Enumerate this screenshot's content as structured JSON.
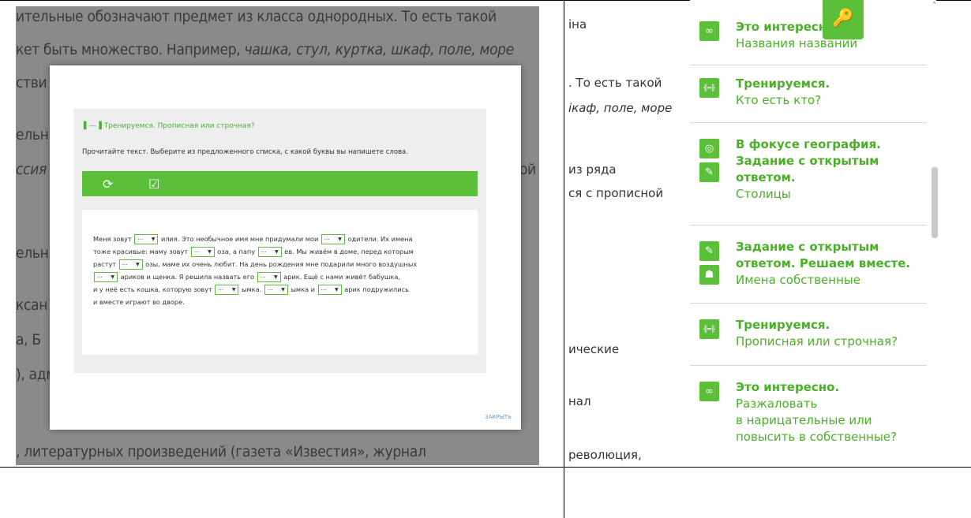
{
  "left": {
    "bg_lines": [
      {
        "text": "ительные обозначают предмет из класса однородных. То есть такой"
      },
      {
        "text": "кет быть множество. Например, ",
        "italic": "чашка, стул, куртка, шкаф, поле, море"
      },
      {
        "text": "стви"
      },
      {
        "text": "ельн"
      },
      {
        "text": "",
        "italic": "ссия"
      },
      {
        "text": "сной"
      },
      {
        "text": "ельн"
      },
      {
        "text": "ксан"
      },
      {
        "text": "а, Б"
      },
      {
        "text": "), адм"
      },
      {
        "text": ", литературных произведений (газета «Известия», журнал"
      }
    ],
    "modal": {
      "task_title": "Тренируемся. Прописная или строчная?",
      "task_desc": "Прочитайте текст. Выберите из предложенного списка, с какой буквы вы напишете слова.",
      "dropdown_value": "...",
      "close_label": "ЗАКРЫТЬ",
      "lines": [
        [
          "Меня зовут ",
          "DD",
          " илия. Это необычное имя мне придумали мои ",
          "DD",
          " одители. Их имена"
        ],
        [
          "тоже красивые: маму зовут ",
          "DD",
          " оза, а папу ",
          "DD",
          " ев. Мы живём в доме, перед которым"
        ],
        [
          "растут ",
          "DD",
          " озы, маме их очень любит. На день рождения мне подарили много воздушных"
        ],
        [
          "DD",
          " ариков и щенка. Я решила назвать его ",
          "DD",
          " арик. Ещё с нами живёт бабушка,"
        ],
        [
          "и у неё есть кошка, которую зовут ",
          "DD",
          " ымка. ",
          "DD",
          " ымка и ",
          "DD",
          " арик подружились"
        ],
        [
          "и вместе играют во дворе."
        ]
      ]
    }
  },
  "middle": [
    {
      "text": "іна"
    },
    {
      "text": ". То есть такой"
    },
    {
      "text": "",
      "italic": "ікаф, поле, море"
    },
    {
      "text": "из ряда"
    },
    {
      "text": "ся с прописной"
    },
    {
      "text": "ические"
    },
    {
      "text": "нал"
    },
    {
      "text": "революция,"
    }
  ],
  "nav": {
    "items": [
      {
        "title": [
          "Это интересно."
        ],
        "sub": [
          "Названия названий"
        ],
        "icons": [
          "binoculars-icon"
        ]
      },
      {
        "title": [
          "Тренируемся."
        ],
        "sub": [
          "Кто есть кто?"
        ],
        "icons": [
          "dumbbell-icon"
        ]
      },
      {
        "title": [
          "В фокусе география.",
          "Задание с открытым",
          "ответом."
        ],
        "sub": [
          "Столицы"
        ],
        "icons": [
          "globe-icon",
          "pencil-icon"
        ]
      },
      {
        "title": [
          "Задание с открытым",
          "ответом. Решаем вместе."
        ],
        "sub": [
          "Имена собственные"
        ],
        "icons": [
          "pencil-icon",
          "group-icon"
        ]
      },
      {
        "title": [
          "Тренируемся."
        ],
        "sub": [
          "Прописная или строчная?"
        ],
        "icons": [
          "dumbbell-icon"
        ]
      },
      {
        "title": [
          "Это интересно."
        ],
        "sub": [
          "Разжаловать",
          "в нарицательные или",
          "повысить в собственные?"
        ],
        "icons": [
          "binoculars-icon"
        ]
      }
    ],
    "key_icon": "key-icon"
  }
}
